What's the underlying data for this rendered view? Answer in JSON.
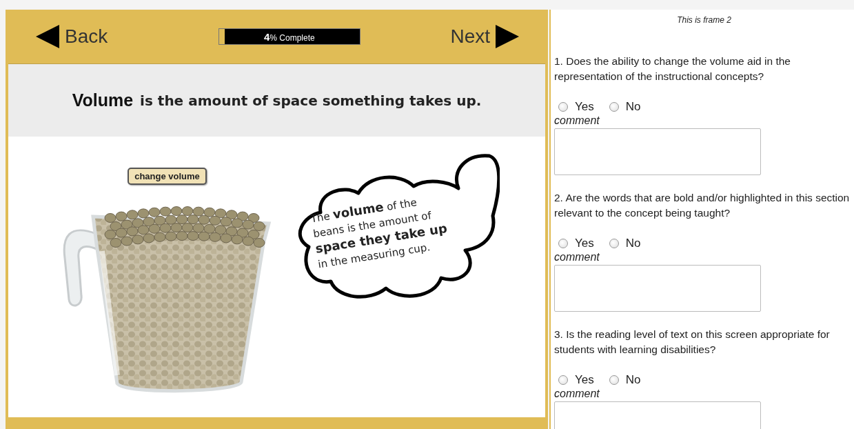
{
  "nav": {
    "back": "Back",
    "next": "Next"
  },
  "progress": {
    "label": "**4**% Complete",
    "level": 0.04
  },
  "banner": {
    "term": "Volume",
    "text": "is the amount of space something takes up."
  },
  "change_button": "change volume",
  "bubble": {
    "lines": [
      "The **volume** of the",
      "beans is the amount of",
      "**space they take up**",
      "in the measuring cup."
    ]
  },
  "frame_label": "This is frame 2",
  "questions": [
    {
      "text": "1. Does the ability to change the volume aid in the representation of the instructional concepts?",
      "options": [
        {
          "label": "Yes",
          "selected": false
        },
        {
          "label": "No",
          "selected": false
        }
      ],
      "comment_label": "comment"
    },
    {
      "text": "2. Are the words that are bold and/or highlighted in this section relevant to the concept being taught?",
      "options": [
        {
          "label": "Yes",
          "selected": false
        },
        {
          "label": "No",
          "selected": false
        }
      ],
      "comment_label": "comment"
    },
    {
      "text": "3. Is the reading level of text on this screen appropriate for students with learning disabilities?",
      "options": [
        {
          "label": "Yes",
          "selected": false
        },
        {
          "label": "No",
          "selected": false
        }
      ],
      "comment_label": "comment"
    }
  ]
}
